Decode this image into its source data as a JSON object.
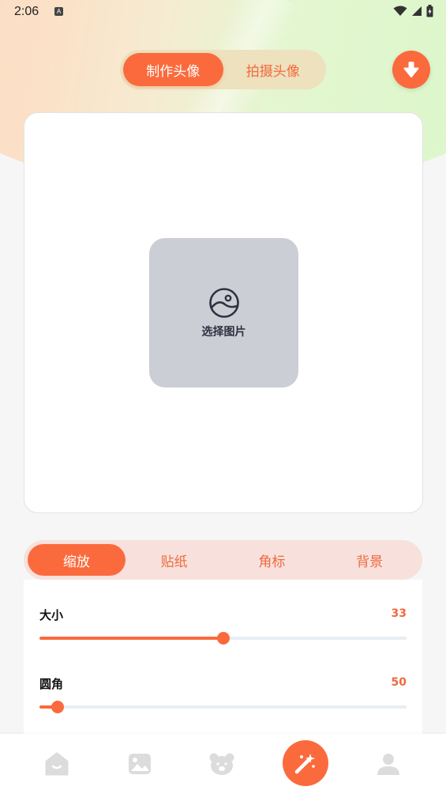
{
  "status_bar": {
    "time": "2:06",
    "icons": [
      "a-notification-icon",
      "wifi-icon",
      "signal-icon",
      "battery-icon"
    ]
  },
  "header": {
    "mode_tabs": [
      {
        "label": "制作头像",
        "active": true
      },
      {
        "label": "拍摄头像",
        "active": false
      }
    ],
    "download_icon": "download-icon"
  },
  "preview": {
    "pick_label": "选择图片",
    "pick_icon": "image-icon"
  },
  "edit": {
    "tabs": [
      {
        "label": "缩放",
        "active": true
      },
      {
        "label": "贴纸",
        "active": false
      },
      {
        "label": "角标",
        "active": false
      },
      {
        "label": "背景",
        "active": false
      }
    ],
    "sliders": [
      {
        "label": "大小",
        "value": "33",
        "fill_fraction": 0.5
      },
      {
        "label": "圆角",
        "value": "50",
        "fill_fraction": 0.05
      }
    ]
  },
  "bottom_nav": {
    "items": [
      "home-icon",
      "gallery-icon",
      "bear-icon",
      "magic-wand-icon",
      "profile-icon"
    ],
    "active": "magic-wand-icon"
  },
  "colors": {
    "accent": "#fb6a3c",
    "tab_bg": "#ede1be",
    "edit_tab_bg": "#f8e1dc",
    "placeholder_bg": "#cbced5",
    "nav_icon": "#d8d8d8"
  }
}
